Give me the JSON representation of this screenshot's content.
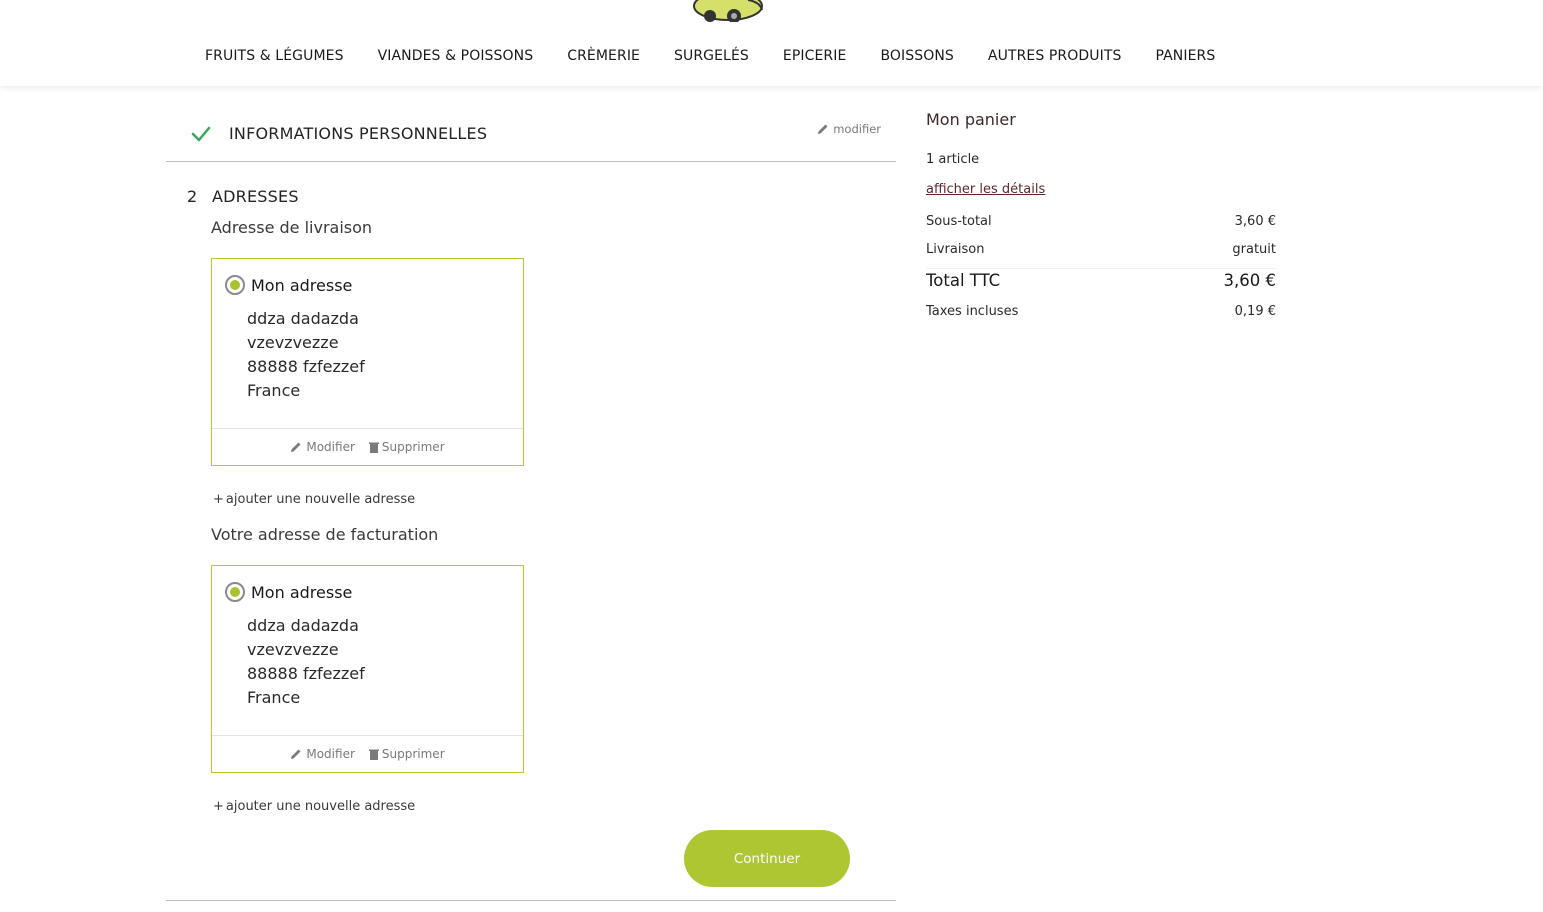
{
  "nav": {
    "items": [
      "FRUITS & LÉGUMES",
      "VIANDES & POISSONS",
      "CRÈMERIE",
      "SURGELÉS",
      "EPICERIE",
      "BOISSONS",
      "AUTRES PRODUITS",
      "PANIERS"
    ]
  },
  "step1": {
    "title": "INFORMATIONS PERSONNELLES",
    "edit_label": "modifier"
  },
  "step2": {
    "number": "2",
    "title": "ADRESSES",
    "delivery_label": "Adresse de livraison",
    "billing_label": "Votre adresse de facturation",
    "add_address_label": "ajouter une nouvelle adresse",
    "delivery_address": {
      "name": "Mon adresse",
      "lines": [
        "ddza dadazda",
        "vzevzvezze",
        "88888 fzfezzef",
        "France"
      ],
      "modify_label": "Modifier",
      "delete_label": "Supprimer"
    },
    "billing_address": {
      "name": "Mon adresse",
      "lines": [
        "ddza dadazda",
        "vzevzvezze",
        "88888 fzfezzef",
        "France"
      ],
      "modify_label": "Modifier",
      "delete_label": "Supprimer"
    },
    "continue_label": "Continuer"
  },
  "cart": {
    "title": "Mon panier",
    "count": "1 article",
    "details_label": "afficher les détails",
    "subtotal_label": "Sous-total",
    "subtotal_value": "3,60 €",
    "shipping_label": "Livraison",
    "shipping_value": "gratuit",
    "total_label": "Total TTC",
    "total_value": "3,60 €",
    "tax_label": "Taxes incluses",
    "tax_value": "0,19 €"
  },
  "colors": {
    "accent": "#aec631",
    "card_border": "#b8c92a",
    "check": "#3aa65a"
  },
  "icons": [
    "check-icon",
    "pencil-icon",
    "trash-icon",
    "plus-icon",
    "radio-selected-icon"
  ]
}
